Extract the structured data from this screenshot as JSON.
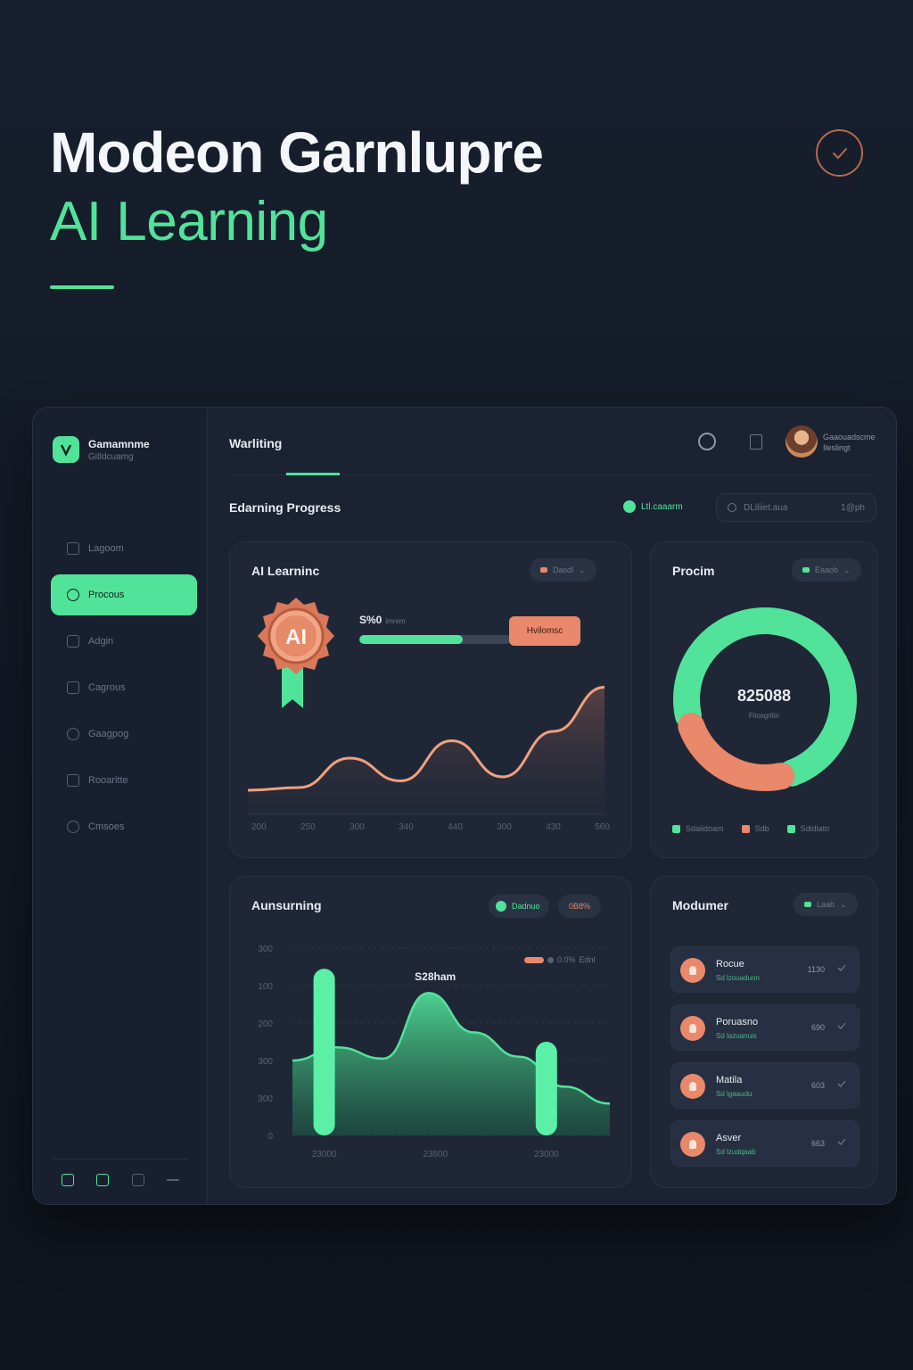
{
  "hero": {
    "title": "Modeon Garnlupre",
    "subtitle": "AI Learning"
  },
  "sidebar": {
    "brand_name": "Gamamnme",
    "brand_tagline": "Gitldcuamg",
    "items": [
      {
        "label": "Lagoom",
        "icon": "list-icon",
        "active": false
      },
      {
        "label": "Procous",
        "icon": "target-icon",
        "active": true
      },
      {
        "label": "Adgin",
        "icon": "user-icon",
        "active": false
      },
      {
        "label": "Cagrous",
        "icon": "calendar-icon",
        "active": false
      },
      {
        "label": "Gaagpog",
        "icon": "clock-icon",
        "active": false
      },
      {
        "label": "Rooaritte",
        "icon": "folder-icon",
        "active": false
      },
      {
        "label": "Cmsoes",
        "icon": "settings-icon",
        "active": false
      }
    ],
    "footer_icons": [
      "home-icon",
      "grid-icon",
      "menu-icon",
      "more-icon"
    ]
  },
  "topbar": {
    "tab_label": "Warliting",
    "user_name": "Gaaouadscme",
    "user_role": "Ileslingt"
  },
  "section": {
    "title": "Edarning Progress",
    "filter_label": "Ltl.caaarm",
    "date_label": "DLiliiet.aua",
    "date_suffix": "1@ph"
  },
  "cards": {
    "ai_learning": {
      "title": "AI Learninc",
      "pill": "Dasdl",
      "badge_text": "AI",
      "progress_label": "S%0",
      "progress_sub": "imrem",
      "progress_button": "Hvilomsc",
      "x_ticks": [
        "200",
        "250",
        "300",
        "340",
        "440",
        "300",
        "430",
        "560"
      ]
    },
    "procm": {
      "title": "Procim",
      "pill": "Eaaob",
      "center_value": "825088",
      "center_sub": "Fliosgritin",
      "legend": [
        {
          "label": "Sdaiidoam",
          "color": "#52e39a"
        },
        {
          "label": "Sdb",
          "color": "#e9886a"
        },
        {
          "label": "Sdidiatn",
          "color": "#52e39a"
        }
      ]
    },
    "auraming": {
      "title": "Aunsurning",
      "pill_green": "Dadnuo",
      "pill_orange": "0B8%",
      "legend_label": "0.0%",
      "legend_suffix": "Ednl",
      "peak_label": "S28ham",
      "y_ticks": [
        "300",
        "100",
        "200",
        "300",
        "300",
        "0"
      ],
      "x_ticks": [
        "23000",
        "23600",
        "23000"
      ]
    },
    "modumer": {
      "title": "Modumer",
      "pill": "Laab",
      "items": [
        {
          "title": "Rocue",
          "sub": "Sd lzouaduon",
          "value": "1130"
        },
        {
          "title": "Poruasno",
          "sub": "Sd lazuanuis",
          "value": "690"
        },
        {
          "title": "Matila",
          "sub": "Sd lgaaudu",
          "value": "603"
        },
        {
          "title": "Asver",
          "sub": "Sd lzudqaab",
          "value": "663"
        }
      ]
    }
  },
  "colors": {
    "accent": "#52e39a",
    "accent_orange": "#e9886a",
    "background": "#17202f",
    "card": "#1f2737"
  },
  "chart_data": [
    {
      "type": "area",
      "title": "AI Learninc",
      "x": [
        "200",
        "250",
        "300",
        "340",
        "440",
        "300",
        "430",
        "560"
      ],
      "series": [
        {
          "values": [
            0.18,
            0.2,
            0.42,
            0.25,
            0.55,
            0.28,
            0.62,
            0.95
          ]
        }
      ],
      "ylim": [
        0,
        1
      ]
    },
    {
      "type": "pie",
      "title": "Procim",
      "series": [
        {
          "values": [
            75,
            25
          ]
        }
      ],
      "colors": [
        "#52e39a",
        "#e9886a"
      ]
    },
    {
      "type": "area",
      "title": "Aunsurning",
      "y_ticks": [
        "300",
        "100",
        "200",
        "300",
        "300",
        "0"
      ],
      "x_ticks": [
        "23000",
        "23600",
        "23000"
      ],
      "bars": [
        {
          "x": 0.1,
          "value": 0.89
        },
        {
          "x": 0.8,
          "value": 0.5
        }
      ],
      "series": [
        {
          "values": [
            0.4,
            0.47,
            0.41,
            0.76,
            0.55,
            0.42,
            0.26,
            0.17
          ]
        }
      ],
      "ylim": [
        0,
        1
      ]
    }
  ]
}
